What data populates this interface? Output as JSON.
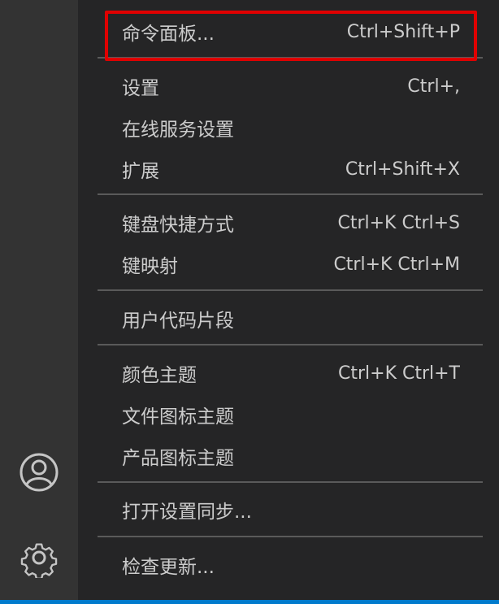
{
  "activity_bar": {
    "icons": [
      "account-icon",
      "gear-icon"
    ]
  },
  "menu": {
    "items": [
      {
        "label": "命令面板...",
        "shortcut": "Ctrl+Shift+P"
      },
      {
        "label": "设置",
        "shortcut": "Ctrl+,"
      },
      {
        "label": "在线服务设置",
        "shortcut": ""
      },
      {
        "label": "扩展",
        "shortcut": "Ctrl+Shift+X"
      },
      {
        "label": "键盘快捷方式",
        "shortcut": "Ctrl+K Ctrl+S"
      },
      {
        "label": "键映射",
        "shortcut": "Ctrl+K Ctrl+M"
      },
      {
        "label": "用户代码片段",
        "shortcut": ""
      },
      {
        "label": "颜色主题",
        "shortcut": "Ctrl+K Ctrl+T"
      },
      {
        "label": "文件图标主题",
        "shortcut": ""
      },
      {
        "label": "产品图标主题",
        "shortcut": ""
      },
      {
        "label": "打开设置同步...",
        "shortcut": ""
      },
      {
        "label": "检查更新...",
        "shortcut": ""
      }
    ]
  },
  "colors": {
    "menu_background": "#252526",
    "activity_bar": "#333333",
    "text": "#cccccc",
    "separator": "#5a5a5a",
    "highlight": "#e00000",
    "status_bar": "#007acc"
  }
}
